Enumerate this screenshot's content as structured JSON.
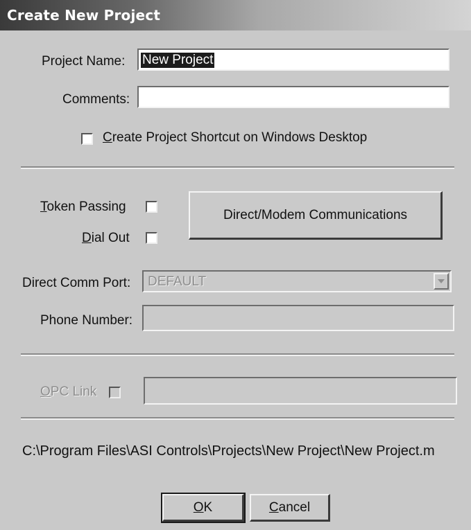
{
  "dialog": {
    "title": "Create New Project"
  },
  "project_name": {
    "label": "Project Name:",
    "value": "New Project"
  },
  "comments": {
    "label": "Comments:",
    "value": ""
  },
  "shortcut": {
    "label_mnemonic": "C",
    "label_rest": "reate Project Shortcut on Windows Desktop",
    "checked": false
  },
  "token_passing": {
    "label_mnemonic": "T",
    "label_rest": "oken Passing",
    "checked": false
  },
  "dial_out": {
    "label_mnemonic": "D",
    "label_rest": "ial Out",
    "checked": false
  },
  "direct_modem_button": {
    "label": "Direct/Modem Communications"
  },
  "direct_comm_port": {
    "label": "Direct Comm Port:",
    "selected": "DEFAULT",
    "enabled": false
  },
  "phone_number": {
    "label": "Phone Number:",
    "value": ""
  },
  "opc_link": {
    "label_mnemonic": "O",
    "label_rest": "PC Link",
    "checked": false,
    "enabled": false,
    "value": ""
  },
  "project_path": "C:\\Program Files\\ASI Controls\\Projects\\New Project\\New Project.m",
  "buttons": {
    "ok_mnemonic": "O",
    "ok_rest": "K",
    "cancel_mnemonic": "C",
    "cancel_rest": "ancel"
  },
  "colors": {
    "dialog_bg": "#c9c9c9",
    "selection_bg": "#1c1c1c",
    "disabled_text": "#8e8e8e"
  }
}
